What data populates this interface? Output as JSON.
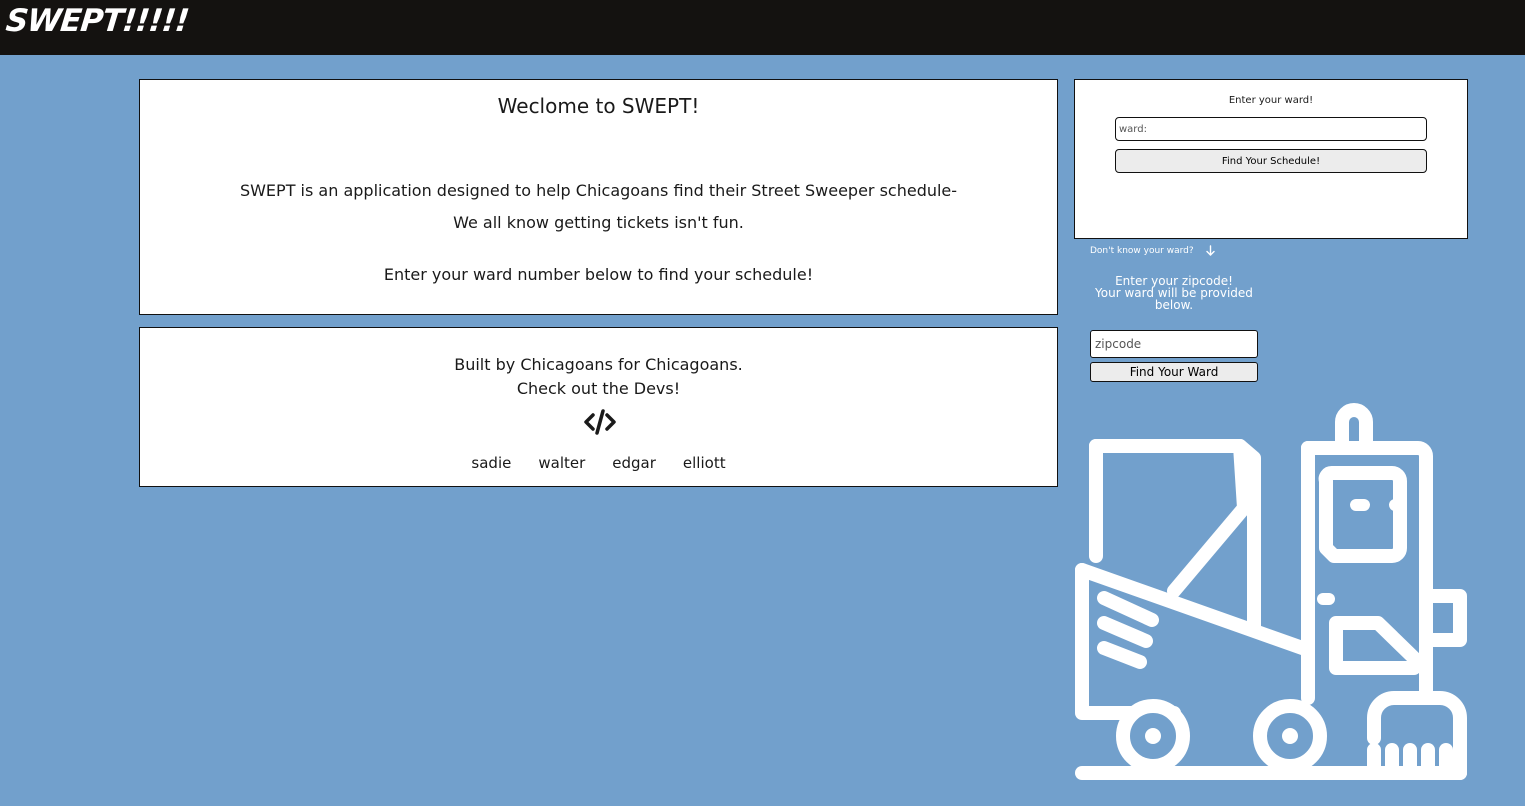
{
  "header": {
    "logo_text": "SWEPT!!!!!"
  },
  "welcome": {
    "title": "Weclome to SWEPT!",
    "line1": "SWEPT is an application designed to help Chicagoans find their Street Sweeper schedule-",
    "line2": "We all know getting tickets isn't fun.",
    "line3": "Enter your ward number below to find your schedule!"
  },
  "devs": {
    "line1": "Built by Chicagoans for Chicagoans.",
    "line2": "Check out the Devs!",
    "icon": "code-icon",
    "names": [
      "sadie",
      "walter",
      "edgar",
      "elliott"
    ]
  },
  "ward_form": {
    "title": "Enter your ward!",
    "input_placeholder": "ward:",
    "input_value": "",
    "button_label": "Find Your Schedule!"
  },
  "zip_help": {
    "toggle_label": "Don't know your ward?",
    "toggle_icon": "arrow-down-icon",
    "instructions_line1": "Enter your zipcode!",
    "instructions_line2": "Your ward will be provided below.",
    "input_placeholder": "zipcode",
    "input_value": "",
    "button_label": "Find Your Ward"
  },
  "illustration": {
    "icon": "street-sweeper-icon"
  },
  "colors": {
    "page_bg": "#72a0cc",
    "header_bg": "#141210",
    "panel_bg": "#ffffff"
  }
}
